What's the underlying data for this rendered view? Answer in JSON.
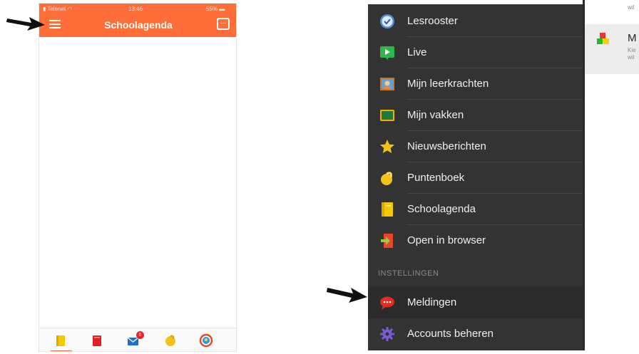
{
  "left_phone": {
    "status": {
      "carrier": "Telenet",
      "time": "13:46",
      "battery": "55%"
    },
    "header": {
      "title": "Schoolagenda",
      "menu_icon": "hamburger-icon",
      "action_icon": "notes-icon",
      "action_label": "..."
    },
    "tabbar": {
      "tabs": [
        {
          "icon": "agenda-icon",
          "color": "#f5c800",
          "active": true
        },
        {
          "icon": "book-icon",
          "color": "#e02020"
        },
        {
          "icon": "messages-icon",
          "color": "#1a73c9",
          "badge": "6"
        },
        {
          "icon": "grades-icon",
          "color": "#f3c21a"
        },
        {
          "icon": "profile-icon",
          "color": "#2f9ad6"
        }
      ],
      "accent": "#ff6d39"
    }
  },
  "menu": {
    "items": [
      {
        "label": "Lesrooster",
        "icon": "clock-icon"
      },
      {
        "label": "Live",
        "icon": "live-play-icon"
      },
      {
        "label": "Mijn leerkrachten",
        "icon": "teacher-icon"
      },
      {
        "label": "Mijn vakken",
        "icon": "blackboard-icon"
      },
      {
        "label": "Nieuwsberichten",
        "icon": "star-icon"
      },
      {
        "label": "Puntenboek",
        "icon": "grades-icon"
      },
      {
        "label": "Schoolagenda",
        "icon": "agenda-icon"
      },
      {
        "label": "Open in browser",
        "icon": "open-browser-icon"
      }
    ],
    "section_header": "INSTELLINGEN",
    "settings": [
      {
        "label": "Meldingen",
        "icon": "chat-bubble-icon"
      },
      {
        "label": "Accounts beheren",
        "icon": "gear-icon"
      }
    ]
  },
  "panel": {
    "top_text": "wil",
    "title": "M",
    "desc_1": "Kie",
    "desc_2": "wil"
  },
  "colors": {
    "header_orange": "#ff6d39",
    "menu_bg": "#333333"
  }
}
